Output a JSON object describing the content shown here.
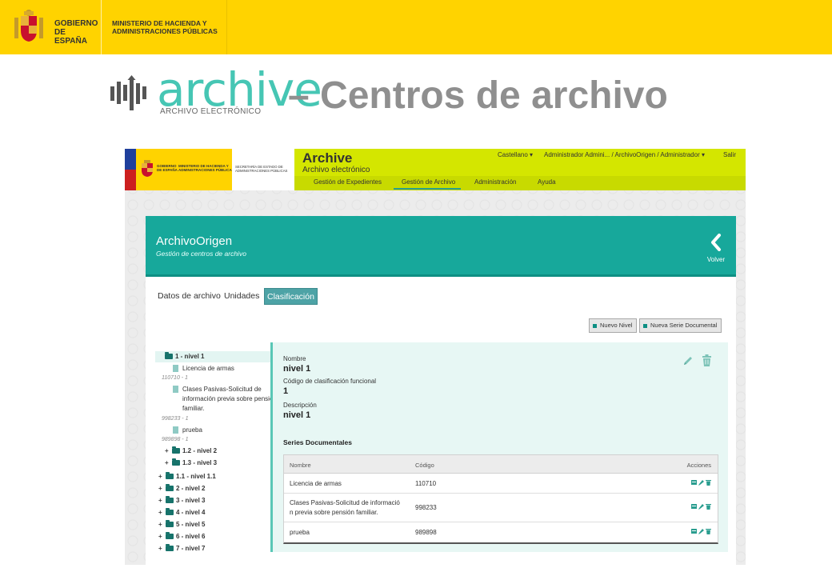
{
  "gov": {
    "line1": "GOBIERNO DE ESPAÑA",
    "line2": "MINISTERIO DE HACIENDA Y ADMINISTRACIONES PÚBLICAS"
  },
  "slide": {
    "logo_word": "archive",
    "logo_sub": "ARCHIVO ELECTRÓNICO",
    "heading": "– Centros de archivo"
  },
  "app": {
    "gov_line1": "GOBIERNO DE ESPAÑA",
    "gov_line2": "MINISTERIO DE HACIENDA Y ADMINISTRACIONES PÚBLICAS",
    "secretaria": "SECRETARÍA DE ESTADO DE ADMINISTRACIONES PÚBLICAS",
    "name": "Archive",
    "subname": "Archivo electrónico",
    "top_menu": {
      "language": "Castellano ▾",
      "user": "Administrador Admini... / ArchivoOrigen / Administrador ▾",
      "logout": "Salir"
    },
    "nav": [
      {
        "label": "Gestión de Expedientes"
      },
      {
        "label": "Gestión de Archivo"
      },
      {
        "label": "Administración"
      },
      {
        "label": "Ayuda"
      }
    ]
  },
  "panel": {
    "title": "ArchivoOrigen",
    "subtitle": "Gestión de centros de archivo",
    "back_label": "Volver",
    "tabs": [
      {
        "label": "Datos de archivo"
      },
      {
        "label": "Unidades"
      },
      {
        "label": "Clasificación"
      }
    ],
    "actions": {
      "new_level": "Nuevo Nivel",
      "new_series": "Nueva Serie Documental"
    }
  },
  "tree": {
    "root": "1 - nivel 1",
    "docs": [
      {
        "name": "Licencia de armas",
        "code": "110710 - 1"
      },
      {
        "name": "Clases Pasivas-Solicitud de",
        "name2": "información previa sobre pensión",
        "name3": "familiar.",
        "code": "998233 - 1"
      },
      {
        "name": "prueba",
        "code": "989898 - 1"
      }
    ],
    "sub": [
      "1.2 - nivel 2",
      "1.3 - nivel 3"
    ],
    "others": [
      "1.1 - nivel 1.1",
      "2 - nivel 2",
      "3 - nivel 3",
      "4 - nivel 4",
      "5 - nivel 5",
      "6 - nivel 6",
      "7 - nivel 7"
    ],
    "plus": "+"
  },
  "detail": {
    "nombre_label": "Nombre",
    "nombre_value": "nivel 1",
    "codigo_label": "Código de clasificación funcional",
    "codigo_value": "1",
    "desc_label": "Descripción",
    "desc_value": "nivel 1",
    "series_title": "Series Documentales",
    "table": {
      "headers": {
        "name": "Nombre",
        "code": "Código",
        "actions": "Acciones"
      },
      "rows": [
        {
          "name": "Licencia de armas",
          "code": "110710"
        },
        {
          "name": "Clases Pasivas-Solicitud de informació",
          "name2": "n previa sobre pensión familiar.",
          "code": "998233"
        },
        {
          "name": "prueba",
          "code": "989898"
        }
      ]
    }
  },
  "colors": {
    "gov_yellow": "#ffd300",
    "app_green": "#d4e600",
    "teal": "#17a89b",
    "logo_teal": "#46c6b4"
  }
}
